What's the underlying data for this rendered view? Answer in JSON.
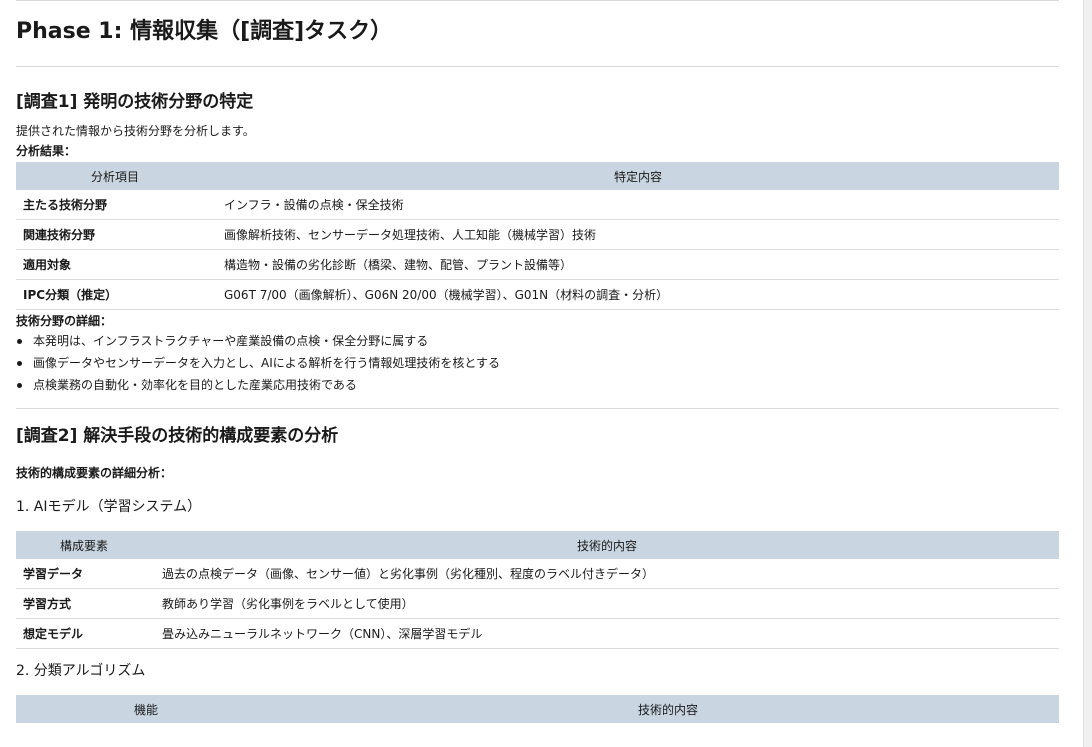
{
  "phase_title": "Phase 1: 情報収集（[調査]タスク）",
  "section1": {
    "heading": "[調査1] 発明の技術分野の特定",
    "description": "提供された情報から技術分野を分析します。",
    "results_label": "分析結果：",
    "table": {
      "headers": [
        "分析項目",
        "特定内容"
      ],
      "rows": [
        [
          "主たる技術分野",
          "インフラ・設備の点検・保全技術"
        ],
        [
          "関連技術分野",
          "画像解析技術、センサーデータ処理技術、人工知能（機械学習）技術"
        ],
        [
          "適用対象",
          "構造物・設備の劣化診断（橋梁、建物、配管、プラント設備等）"
        ],
        [
          "IPC分類（推定）",
          "G06T 7/00（画像解析）、G06N 20/00（機械学習）、G01N（材料の調査・分析）"
        ]
      ]
    },
    "details_label": "技術分野の詳細：",
    "details": [
      "本発明は、インフラストラクチャーや産業設備の点検・保全分野に属する",
      "画像データやセンサーデータを入力とし、AIによる解析を行う情報処理技術を核とする",
      "点検業務の自動化・効率化を目的とした産業応用技術である"
    ]
  },
  "section2": {
    "heading": "[調査2] 解決手段の技術的構成要素の分析",
    "analysis_label": "技術的構成要素の詳細分析：",
    "sub1": {
      "title": "1. AIモデル（学習システム）",
      "headers": [
        "構成要素",
        "技術的内容"
      ],
      "rows": [
        [
          "学習データ",
          "過去の点検データ（画像、センサー値）と劣化事例（劣化種別、程度のラベル付きデータ）"
        ],
        [
          "学習方式",
          "教師あり学習（劣化事例をラベルとして使用）"
        ],
        [
          "想定モデル",
          "畳み込みニューラルネットワーク（CNN）、深層学習モデル"
        ]
      ]
    },
    "sub2": {
      "title": "2. 分類アルゴリズム",
      "headers": [
        "機能",
        "技術的内容"
      ]
    }
  }
}
